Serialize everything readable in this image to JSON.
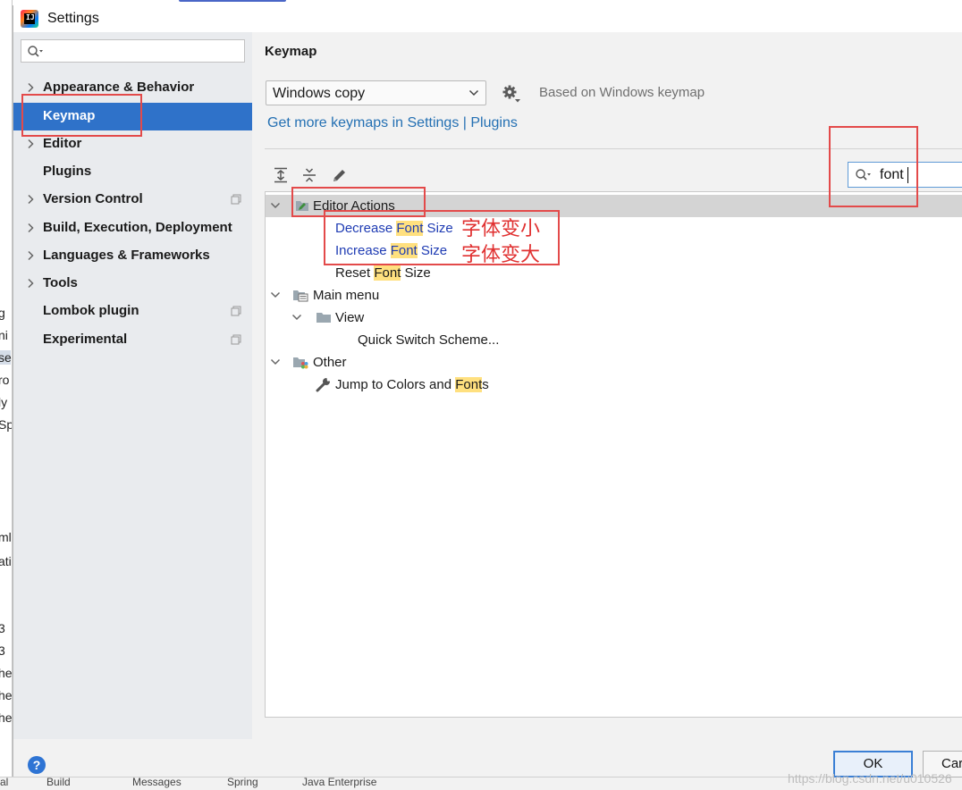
{
  "window": {
    "title": "Settings"
  },
  "sidebar": {
    "search_placeholder": "",
    "items": [
      {
        "label": "Appearance & Behavior",
        "expandable": true,
        "selected": false,
        "project": false
      },
      {
        "label": "Keymap",
        "expandable": false,
        "selected": true,
        "project": false
      },
      {
        "label": "Editor",
        "expandable": true,
        "selected": false,
        "project": false
      },
      {
        "label": "Plugins",
        "expandable": false,
        "selected": false,
        "project": false
      },
      {
        "label": "Version Control",
        "expandable": true,
        "selected": false,
        "project": true
      },
      {
        "label": "Build, Execution, Deployment",
        "expandable": true,
        "selected": false,
        "project": false
      },
      {
        "label": "Languages & Frameworks",
        "expandable": true,
        "selected": false,
        "project": false
      },
      {
        "label": "Tools",
        "expandable": true,
        "selected": false,
        "project": false
      },
      {
        "label": "Lombok plugin",
        "expandable": false,
        "selected": false,
        "project": true
      },
      {
        "label": "Experimental",
        "expandable": false,
        "selected": false,
        "project": true
      }
    ]
  },
  "main": {
    "title": "Keymap",
    "keymap_value": "Windows copy",
    "based_on": "Based on Windows keymap",
    "get_more_link": "Get more keymaps in Settings | Plugins",
    "filter_value": "font",
    "tree": {
      "editor_actions": "Editor Actions",
      "decrease": {
        "pre": "Decrease ",
        "hl": "Font",
        "post": " Size"
      },
      "increase": {
        "pre": "Increase ",
        "hl": "Font",
        "post": " Size"
      },
      "reset": {
        "pre": "Reset ",
        "hl": "Font",
        "post": " Size"
      },
      "main_menu": "Main menu",
      "view": "View",
      "quick_switch": "Quick Switch Scheme...",
      "other": "Other",
      "jump": {
        "pre": "Jump to Colors and ",
        "hl": "Font",
        "post": "s"
      }
    },
    "annotations": {
      "decrease_note": "字体变小",
      "increase_note": "字体变大"
    }
  },
  "footer": {
    "help": "?",
    "ok": "OK",
    "cancel": "Car"
  },
  "watermark": "https://blog.csdn.net/u010526",
  "background": {
    "left_fragments": [
      "g",
      "ni",
      "se",
      "ro",
      "ly",
      "Sp",
      "ml",
      "ati",
      "3",
      "3",
      "he",
      "he",
      "he",
      "al"
    ],
    "bottom_tabs": [
      "Build",
      "Messages",
      "Spring",
      "Java Enterprise"
    ]
  },
  "colors": {
    "selection": "#2f72c9",
    "highlight": "#ffe07f",
    "annotation": "#e34a4a",
    "link": "#2470b3",
    "action_text": "#1e3bb3"
  }
}
